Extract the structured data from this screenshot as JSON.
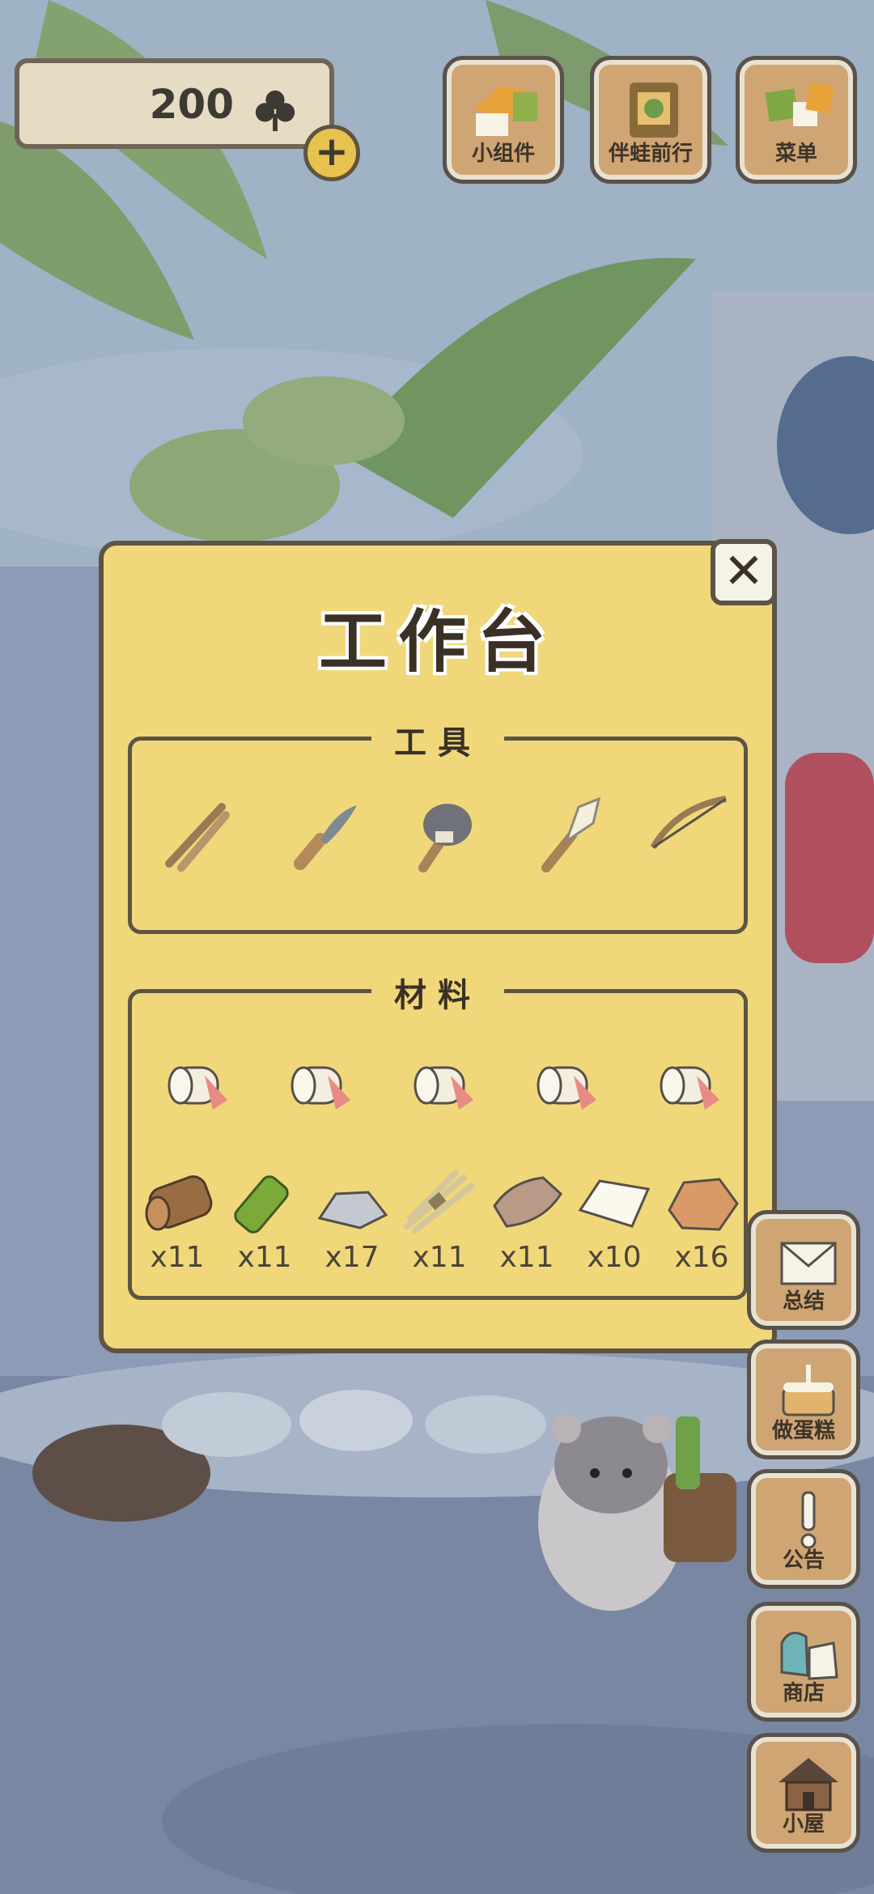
{
  "currency": {
    "value": "200",
    "icon": "clover-icon"
  },
  "top_buttons": [
    {
      "label": "小组件",
      "icon": "widget-icon"
    },
    {
      "label": "伴蛙前行",
      "icon": "frog-journey-icon"
    },
    {
      "label": "菜单",
      "icon": "menu-icon"
    }
  ],
  "dialog": {
    "title": "工作台",
    "tools_title": "工具",
    "materials_title": "材料",
    "tools": [
      "shears-icon",
      "knife-icon",
      "stone-hammer-icon",
      "brush-icon",
      "bow-saw-icon"
    ],
    "material_rolls": [
      "cloth-roll-icon",
      "cloth-roll-icon",
      "cloth-roll-icon",
      "cloth-roll-icon",
      "cloth-roll-icon"
    ],
    "materials": [
      {
        "icon": "wood-log-icon",
        "qty": "x11"
      },
      {
        "icon": "bamboo-icon",
        "qty": "x11"
      },
      {
        "icon": "stone-icon",
        "qty": "x17"
      },
      {
        "icon": "straw-bundle-icon",
        "qty": "x11"
      },
      {
        "icon": "leather-icon",
        "qty": "x11"
      },
      {
        "icon": "paper-icon",
        "qty": "x10"
      },
      {
        "icon": "clay-icon",
        "qty": "x16"
      }
    ]
  },
  "side_buttons": [
    {
      "label": "总结",
      "icon": "letter-icon"
    },
    {
      "label": "做蛋糕",
      "icon": "cake-icon"
    },
    {
      "label": "公告",
      "icon": "exclamation-icon"
    },
    {
      "label": "商店",
      "icon": "shop-icon"
    },
    {
      "label": "小屋",
      "icon": "house-icon"
    }
  ]
}
